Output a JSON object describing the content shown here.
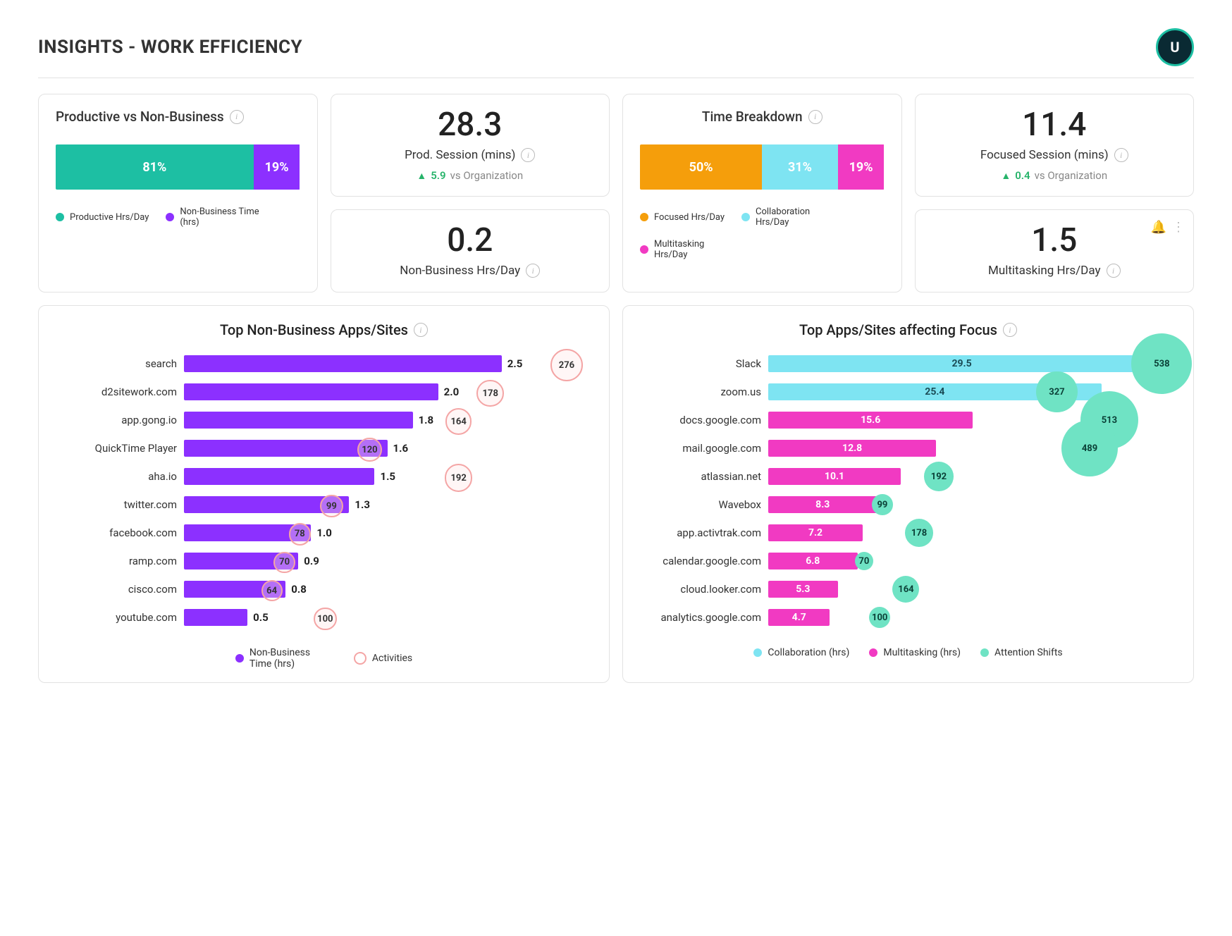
{
  "header": {
    "title": "INSIGHTS - WORK EFFICIENCY",
    "avatar_initial": "U"
  },
  "colors": {
    "teal": "#1DBFA3",
    "purple": "#8C30FF",
    "orange": "#F59E0B",
    "cyan": "#7EE4F2",
    "magenta": "#F13AC2",
    "mint": "#6FE3C4",
    "pink_ring": "#F4A5A5"
  },
  "cards": {
    "prod_vs_nonbiz": {
      "title": "Productive vs Non-Business",
      "segments": [
        {
          "pct": 81,
          "label": "81%",
          "color": "teal",
          "legend": "Productive Hrs/Day"
        },
        {
          "pct": 19,
          "label": "19%",
          "color": "purple",
          "legend": "Non-Business Time (hrs)"
        }
      ]
    },
    "prod_session": {
      "value": "28.3",
      "label": "Prod. Session (mins)",
      "delta": "5.9",
      "delta_vs": "vs Organization"
    },
    "nonbiz_hrs": {
      "value": "0.2",
      "label": "Non-Business Hrs/Day"
    },
    "time_breakdown": {
      "title": "Time Breakdown",
      "segments": [
        {
          "pct": 50,
          "label": "50%",
          "color": "orange",
          "legend": "Focused Hrs/Day"
        },
        {
          "pct": 31,
          "label": "31%",
          "color": "cyan",
          "legend": "Collaboration Hrs/Day"
        },
        {
          "pct": 19,
          "label": "19%",
          "color": "magenta",
          "legend": "Multitasking Hrs/Day"
        }
      ]
    },
    "focused_session": {
      "value": "11.4",
      "label": "Focused Session (mins)",
      "delta": "0.4",
      "delta_vs": "vs Organization"
    },
    "multitasking": {
      "value": "1.5",
      "label": "Multitasking Hrs/Day"
    }
  },
  "chart_data": [
    {
      "type": "bar",
      "title": "Top Non-Business Apps/Sites",
      "orientation": "horizontal",
      "xlabel": "Non-Business Time (hrs)",
      "series": [
        {
          "name": "Non-Business Time (hrs)",
          "color": "purple",
          "categories": [
            "search",
            "d2sitework.com",
            "app.gong.io",
            "QuickTime Player",
            "aha.io",
            "twitter.com",
            "facebook.com",
            "ramp.com",
            "cisco.com",
            "youtube.com"
          ],
          "values": [
            2.5,
            2.0,
            1.8,
            1.6,
            1.5,
            1.3,
            1.0,
            0.9,
            0.8,
            0.5
          ]
        },
        {
          "name": "Activities",
          "color": "pink_ring",
          "style": "bubble",
          "categories": [
            "search",
            "d2sitework.com",
            "app.gong.io",
            "QuickTime Player",
            "aha.io",
            "twitter.com",
            "facebook.com",
            "ramp.com",
            "cisco.com",
            "youtube.com"
          ],
          "values": [
            276,
            178,
            164,
            120,
            192,
            99,
            78,
            70,
            64,
            100
          ],
          "bubble_offsets": [
            3.0,
            2.4,
            2.15,
            1.45,
            2.15,
            1.15,
            0.9,
            0.78,
            0.68,
            1.1
          ]
        }
      ],
      "x_max": 3.2,
      "legend": [
        "Non-Business Time (hrs)",
        "Activities"
      ]
    },
    {
      "type": "bar",
      "title": "Top Apps/Sites affecting Focus",
      "orientation": "horizontal",
      "categories": [
        "Slack",
        "zoom.us",
        "docs.google.com",
        "mail.google.com",
        "atlassian.net",
        "Wavebox",
        "app.activtrak.com",
        "calendar.google.com",
        "cloud.looker.com",
        "analytics.google.com"
      ],
      "series": [
        {
          "name": "Collaboration (hrs)",
          "color": "cyan",
          "values": [
            29.5,
            25.4,
            0,
            0,
            0,
            0,
            0,
            0,
            0,
            0
          ]
        },
        {
          "name": "Multitasking (hrs)",
          "color": "magenta",
          "values": [
            0,
            0,
            15.6,
            12.8,
            10.1,
            8.3,
            7.2,
            6.8,
            5.3,
            4.7
          ]
        },
        {
          "name": "Attention Shifts",
          "color": "mint",
          "style": "bubble",
          "values": [
            538,
            327,
            513,
            489,
            192,
            99,
            178,
            70,
            164,
            100
          ],
          "bubble_offsets": [
            30,
            22,
            26,
            24.5,
            13,
            8.7,
            11.5,
            7.3,
            10.5,
            8.5
          ]
        }
      ],
      "x_max": 31,
      "legend": [
        "Collaboration (hrs)",
        "Multitasking (hrs)",
        "Attention Shifts"
      ]
    }
  ]
}
